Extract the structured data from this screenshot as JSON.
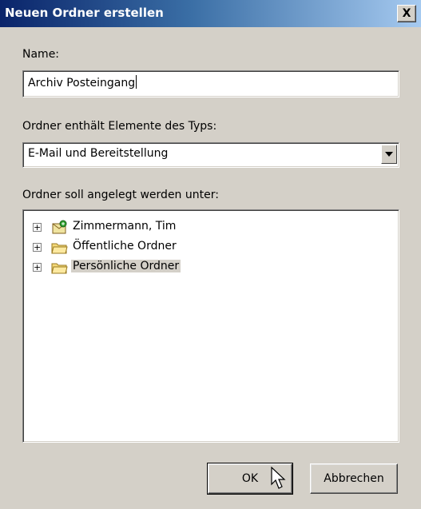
{
  "dialog": {
    "title": "Neuen Ordner erstellen",
    "close_label": "X"
  },
  "name_field": {
    "label": "Name:",
    "value": "Archiv Posteingang"
  },
  "type_field": {
    "label": "Ordner enthält Elemente des Typs:",
    "selected": "E-Mail und Bereitstellung"
  },
  "location": {
    "label": "Ordner soll angelegt werden unter:",
    "items": [
      {
        "label": "Zimmermann, Tim",
        "expander": "+",
        "icon": "mailbox-icon"
      },
      {
        "label": "Öffentliche Ordner",
        "expander": "+",
        "icon": "folder-icon"
      },
      {
        "label": "Persönliche Ordner",
        "expander": "+",
        "icon": "folder-icon",
        "selected": true
      }
    ]
  },
  "buttons": {
    "ok": "OK",
    "cancel": "Abbrechen"
  }
}
